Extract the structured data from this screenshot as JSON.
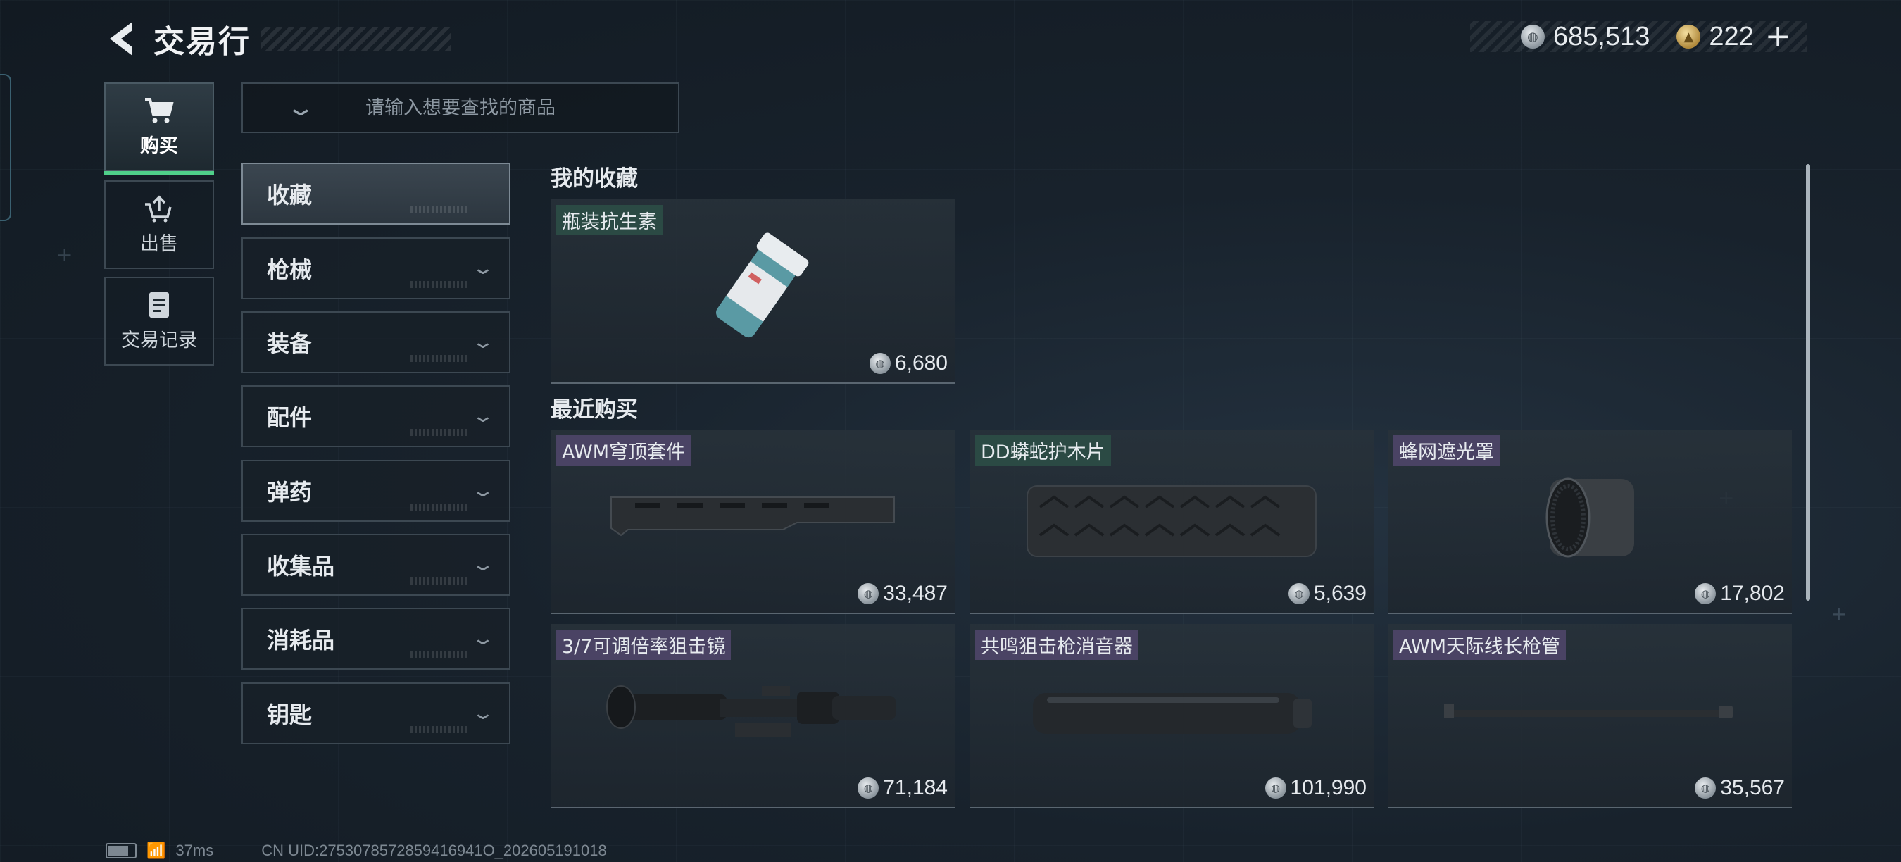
{
  "header": {
    "title": "交易行"
  },
  "currency": {
    "silver": "685,513",
    "gold": "222",
    "add": "+"
  },
  "nav": [
    {
      "label": "购买",
      "icon": "cart-icon"
    },
    {
      "label": "出售",
      "icon": "sell-icon"
    },
    {
      "label": "交易记录",
      "icon": "record-icon"
    }
  ],
  "search": {
    "placeholder": "请输入想要查找的商品"
  },
  "categories": [
    "收藏",
    "枪械",
    "装备",
    "配件",
    "弹药",
    "收集品",
    "消耗品",
    "钥匙"
  ],
  "sections": {
    "favorites": {
      "title": "我的收藏",
      "items": [
        {
          "name": "瓶装抗生素",
          "price": "6,680"
        }
      ]
    },
    "recent": {
      "title": "最近购买",
      "items": [
        {
          "name": "AWM穹顶套件",
          "price": "33,487"
        },
        {
          "name": "DD蟒蛇护木片",
          "price": "5,639"
        },
        {
          "name": "蜂网遮光罩",
          "price": "17,802"
        },
        {
          "name": "3/7可调倍率狙击镜",
          "price": "71,184"
        },
        {
          "name": "共鸣狙击枪消音器",
          "price": "101,990"
        },
        {
          "name": "AWM天际线长枪管",
          "price": "35,567"
        }
      ]
    }
  },
  "footer": {
    "ping": "37ms",
    "uid": "CN UID:2753078572859416941O_202605191018"
  },
  "colors": {
    "accent": "#4fd08a",
    "tag_green": "#2b4a44",
    "tag_purple": "#4a4364"
  }
}
